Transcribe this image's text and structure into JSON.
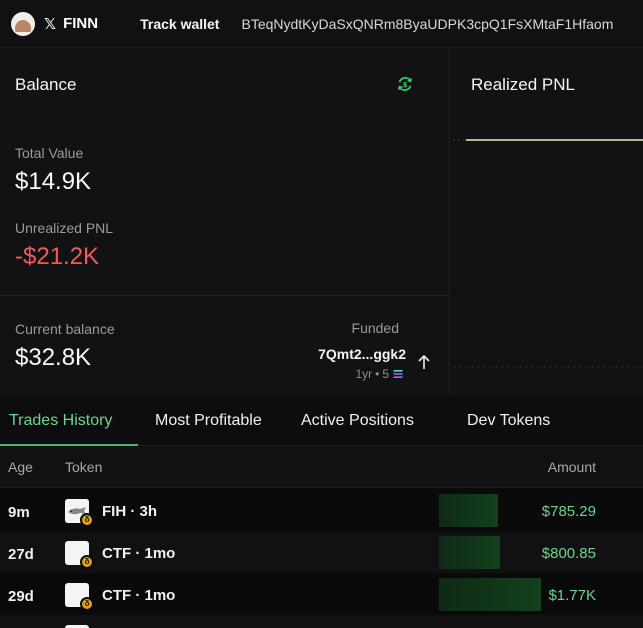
{
  "header": {
    "brand": "FINN",
    "x_icon": "x-logo-icon",
    "track_label": "Track wallet",
    "wallet_address": "BTeqNydtKyDaSxQNRm8ByaUDPK3cpQ1FsXMtaF1Hfaom"
  },
  "balance": {
    "title": "Balance",
    "refresh_icon": "refresh-icon",
    "total_value_label": "Total Value",
    "total_value": "$14.9K",
    "unrealized_label": "Unrealized PNL",
    "unrealized_value": "-$21.2K",
    "current_label": "Current balance",
    "current_value": "$32.8K",
    "funded_label": "Funded",
    "funded_address": "7Qmt2...ggk2",
    "funded_age": "1yr",
    "funded_amount": "5",
    "sol_icon": "solana-icon",
    "arrow_icon": "arrow-up-icon"
  },
  "realized_pnl": {
    "title": "Realized PNL"
  },
  "tabs": [
    {
      "label": "Trades History",
      "active": true
    },
    {
      "label": "Most Profitable",
      "active": false
    },
    {
      "label": "Active Positions",
      "active": false
    },
    {
      "label": "Dev Tokens",
      "active": false
    }
  ],
  "table": {
    "columns": {
      "age": "Age",
      "token": "Token",
      "amount": "Amount"
    },
    "rows": [
      {
        "age": "9m",
        "token": "FIH · 3h",
        "amount": "$785.29",
        "bar_fraction": 0.29
      },
      {
        "age": "27d",
        "token": "CTF · 1mo",
        "amount": "$800.85",
        "bar_fraction": 0.3
      },
      {
        "age": "29d",
        "token": "CTF · 1mo",
        "amount": "$1.77K",
        "bar_fraction": 0.5
      }
    ]
  },
  "colors": {
    "accent_green": "#6dd68a",
    "negative_red": "#f25a5a",
    "pnl_line": "#bfb591"
  }
}
